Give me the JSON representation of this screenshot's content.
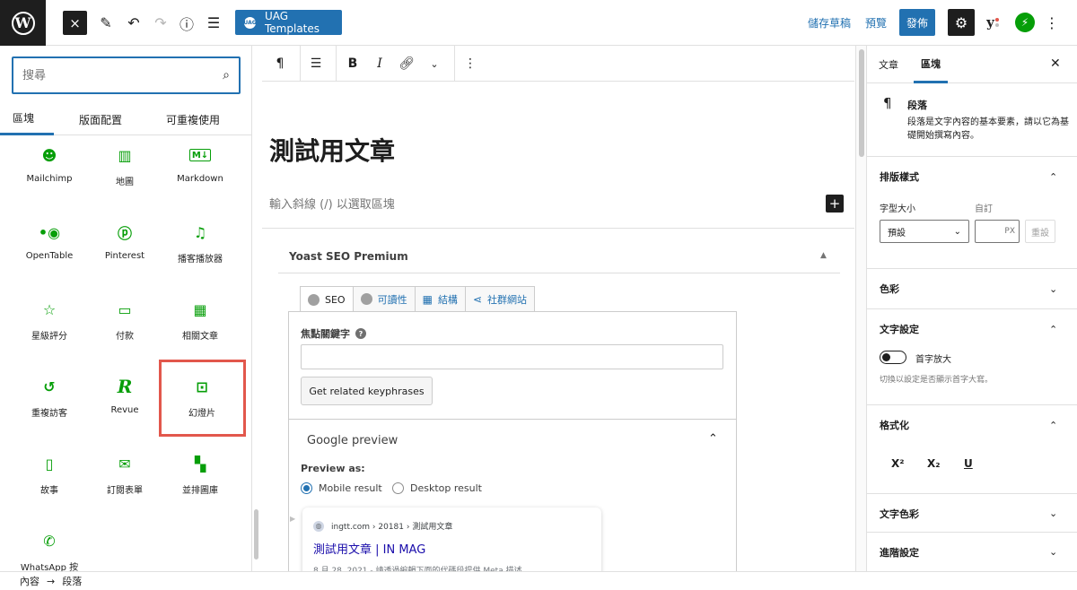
{
  "topbar": {
    "close_icon": "×",
    "uag_label": "UAG Templates",
    "uag_logo_text": "UAG",
    "save_draft": "儲存草稿",
    "preview": "預覽",
    "publish": "發佈"
  },
  "inserter": {
    "search_placeholder": "搜尋",
    "tabs": [
      "區塊",
      "版面配置",
      "可重複使用"
    ],
    "blocks": [
      {
        "label": "Mailchimp",
        "icon": "mailchimp-icon"
      },
      {
        "label": "地圖",
        "icon": "map-icon"
      },
      {
        "label": "Markdown",
        "icon": "markdown-icon"
      },
      {
        "label": "OpenTable",
        "icon": "opentable-icon"
      },
      {
        "label": "Pinterest",
        "icon": "pinterest-icon"
      },
      {
        "label": "播客播放器",
        "icon": "podcast-icon"
      },
      {
        "label": "星級評分",
        "icon": "star-icon"
      },
      {
        "label": "付款",
        "icon": "payment-icon"
      },
      {
        "label": "相關文章",
        "icon": "related-posts-icon"
      },
      {
        "label": "重複訪客",
        "icon": "repeat-visitor-icon"
      },
      {
        "label": "Revue",
        "icon": "revue-icon"
      },
      {
        "label": "幻燈片",
        "icon": "slideshow-icon"
      },
      {
        "label": "故事",
        "icon": "story-icon"
      },
      {
        "label": "訂閱表單",
        "icon": "subscription-icon"
      },
      {
        "label": "並排圖庫",
        "icon": "tiled-gallery-icon"
      },
      {
        "label": "WhatsApp 按",
        "icon": "whatsapp-icon"
      }
    ]
  },
  "editor": {
    "title": "測試用文章",
    "block_prompt": "輸入斜線 (/) 以選取區塊",
    "yoast": {
      "title": "Yoast SEO Premium",
      "tabs": [
        "SEO",
        "可讀性",
        "結構",
        "社群網站"
      ],
      "focus_keyphrase_label": "焦點關鍵字",
      "related_button": "Get related keyphrases",
      "google_preview": "Google preview",
      "preview_as": "Preview as:",
      "mobile_result": "Mobile result",
      "desktop_result": "Desktop result",
      "serp_url": "ingtt.com › 20181 › 測試用文章",
      "serp_title": "測試用文章 | IN MAG",
      "serp_desc": "8 月 28, 2021 - 請透過編輯下面的代碼段提供 Meta 描述。"
    }
  },
  "sidebar": {
    "tabs": [
      "文章",
      "區塊"
    ],
    "block_name": "段落",
    "block_desc": "段落是文字內容的基本要素，請以它為基礎開始撰寫內容。",
    "typography": {
      "title": "排版樣式",
      "font_size_label": "字型大小",
      "custom_label": "自訂",
      "default_option": "預設",
      "px": "PX",
      "reset": "重設"
    },
    "color": "色彩",
    "text_settings": {
      "title": "文字設定",
      "dropcap": "首字放大",
      "dropcap_help": "切換以設定是否顯示首字大寫。"
    },
    "formatting": {
      "title": "格式化",
      "superscript": "X²",
      "subscript": "X₂",
      "underline": "U"
    },
    "text_color": "文字色彩",
    "advanced": "進階設定"
  },
  "breadcrumb": [
    "內容",
    "段落"
  ],
  "colors": {
    "accent": "#2271b1",
    "jetpack_green": "#069e08",
    "highlight_red": "#e2574c"
  }
}
